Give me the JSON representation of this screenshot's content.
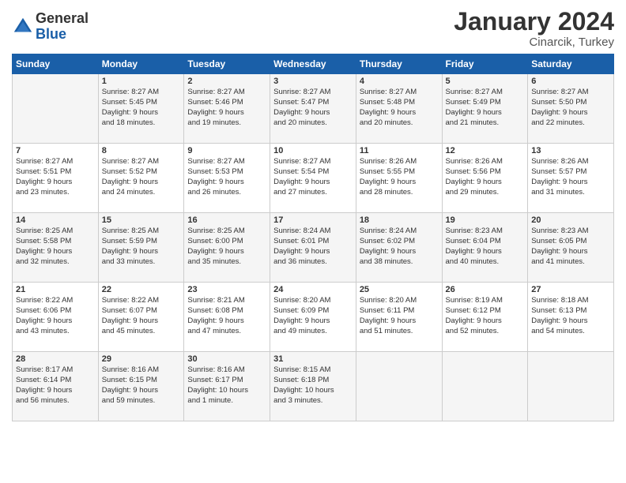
{
  "logo": {
    "general": "General",
    "blue": "Blue"
  },
  "header": {
    "month": "January 2024",
    "location": "Cinarcik, Turkey"
  },
  "columns": [
    "Sunday",
    "Monday",
    "Tuesday",
    "Wednesday",
    "Thursday",
    "Friday",
    "Saturday"
  ],
  "weeks": [
    [
      {
        "day": "",
        "lines": []
      },
      {
        "day": "1",
        "lines": [
          "Sunrise: 8:27 AM",
          "Sunset: 5:45 PM",
          "Daylight: 9 hours",
          "and 18 minutes."
        ]
      },
      {
        "day": "2",
        "lines": [
          "Sunrise: 8:27 AM",
          "Sunset: 5:46 PM",
          "Daylight: 9 hours",
          "and 19 minutes."
        ]
      },
      {
        "day": "3",
        "lines": [
          "Sunrise: 8:27 AM",
          "Sunset: 5:47 PM",
          "Daylight: 9 hours",
          "and 20 minutes."
        ]
      },
      {
        "day": "4",
        "lines": [
          "Sunrise: 8:27 AM",
          "Sunset: 5:48 PM",
          "Daylight: 9 hours",
          "and 20 minutes."
        ]
      },
      {
        "day": "5",
        "lines": [
          "Sunrise: 8:27 AM",
          "Sunset: 5:49 PM",
          "Daylight: 9 hours",
          "and 21 minutes."
        ]
      },
      {
        "day": "6",
        "lines": [
          "Sunrise: 8:27 AM",
          "Sunset: 5:50 PM",
          "Daylight: 9 hours",
          "and 22 minutes."
        ]
      }
    ],
    [
      {
        "day": "7",
        "lines": [
          "Sunrise: 8:27 AM",
          "Sunset: 5:51 PM",
          "Daylight: 9 hours",
          "and 23 minutes."
        ]
      },
      {
        "day": "8",
        "lines": [
          "Sunrise: 8:27 AM",
          "Sunset: 5:52 PM",
          "Daylight: 9 hours",
          "and 24 minutes."
        ]
      },
      {
        "day": "9",
        "lines": [
          "Sunrise: 8:27 AM",
          "Sunset: 5:53 PM",
          "Daylight: 9 hours",
          "and 26 minutes."
        ]
      },
      {
        "day": "10",
        "lines": [
          "Sunrise: 8:27 AM",
          "Sunset: 5:54 PM",
          "Daylight: 9 hours",
          "and 27 minutes."
        ]
      },
      {
        "day": "11",
        "lines": [
          "Sunrise: 8:26 AM",
          "Sunset: 5:55 PM",
          "Daylight: 9 hours",
          "and 28 minutes."
        ]
      },
      {
        "day": "12",
        "lines": [
          "Sunrise: 8:26 AM",
          "Sunset: 5:56 PM",
          "Daylight: 9 hours",
          "and 29 minutes."
        ]
      },
      {
        "day": "13",
        "lines": [
          "Sunrise: 8:26 AM",
          "Sunset: 5:57 PM",
          "Daylight: 9 hours",
          "and 31 minutes."
        ]
      }
    ],
    [
      {
        "day": "14",
        "lines": [
          "Sunrise: 8:25 AM",
          "Sunset: 5:58 PM",
          "Daylight: 9 hours",
          "and 32 minutes."
        ]
      },
      {
        "day": "15",
        "lines": [
          "Sunrise: 8:25 AM",
          "Sunset: 5:59 PM",
          "Daylight: 9 hours",
          "and 33 minutes."
        ]
      },
      {
        "day": "16",
        "lines": [
          "Sunrise: 8:25 AM",
          "Sunset: 6:00 PM",
          "Daylight: 9 hours",
          "and 35 minutes."
        ]
      },
      {
        "day": "17",
        "lines": [
          "Sunrise: 8:24 AM",
          "Sunset: 6:01 PM",
          "Daylight: 9 hours",
          "and 36 minutes."
        ]
      },
      {
        "day": "18",
        "lines": [
          "Sunrise: 8:24 AM",
          "Sunset: 6:02 PM",
          "Daylight: 9 hours",
          "and 38 minutes."
        ]
      },
      {
        "day": "19",
        "lines": [
          "Sunrise: 8:23 AM",
          "Sunset: 6:04 PM",
          "Daylight: 9 hours",
          "and 40 minutes."
        ]
      },
      {
        "day": "20",
        "lines": [
          "Sunrise: 8:23 AM",
          "Sunset: 6:05 PM",
          "Daylight: 9 hours",
          "and 41 minutes."
        ]
      }
    ],
    [
      {
        "day": "21",
        "lines": [
          "Sunrise: 8:22 AM",
          "Sunset: 6:06 PM",
          "Daylight: 9 hours",
          "and 43 minutes."
        ]
      },
      {
        "day": "22",
        "lines": [
          "Sunrise: 8:22 AM",
          "Sunset: 6:07 PM",
          "Daylight: 9 hours",
          "and 45 minutes."
        ]
      },
      {
        "day": "23",
        "lines": [
          "Sunrise: 8:21 AM",
          "Sunset: 6:08 PM",
          "Daylight: 9 hours",
          "and 47 minutes."
        ]
      },
      {
        "day": "24",
        "lines": [
          "Sunrise: 8:20 AM",
          "Sunset: 6:09 PM",
          "Daylight: 9 hours",
          "and 49 minutes."
        ]
      },
      {
        "day": "25",
        "lines": [
          "Sunrise: 8:20 AM",
          "Sunset: 6:11 PM",
          "Daylight: 9 hours",
          "and 51 minutes."
        ]
      },
      {
        "day": "26",
        "lines": [
          "Sunrise: 8:19 AM",
          "Sunset: 6:12 PM",
          "Daylight: 9 hours",
          "and 52 minutes."
        ]
      },
      {
        "day": "27",
        "lines": [
          "Sunrise: 8:18 AM",
          "Sunset: 6:13 PM",
          "Daylight: 9 hours",
          "and 54 minutes."
        ]
      }
    ],
    [
      {
        "day": "28",
        "lines": [
          "Sunrise: 8:17 AM",
          "Sunset: 6:14 PM",
          "Daylight: 9 hours",
          "and 56 minutes."
        ]
      },
      {
        "day": "29",
        "lines": [
          "Sunrise: 8:16 AM",
          "Sunset: 6:15 PM",
          "Daylight: 9 hours",
          "and 59 minutes."
        ]
      },
      {
        "day": "30",
        "lines": [
          "Sunrise: 8:16 AM",
          "Sunset: 6:17 PM",
          "Daylight: 10 hours",
          "and 1 minute."
        ]
      },
      {
        "day": "31",
        "lines": [
          "Sunrise: 8:15 AM",
          "Sunset: 6:18 PM",
          "Daylight: 10 hours",
          "and 3 minutes."
        ]
      },
      {
        "day": "",
        "lines": []
      },
      {
        "day": "",
        "lines": []
      },
      {
        "day": "",
        "lines": []
      }
    ]
  ]
}
